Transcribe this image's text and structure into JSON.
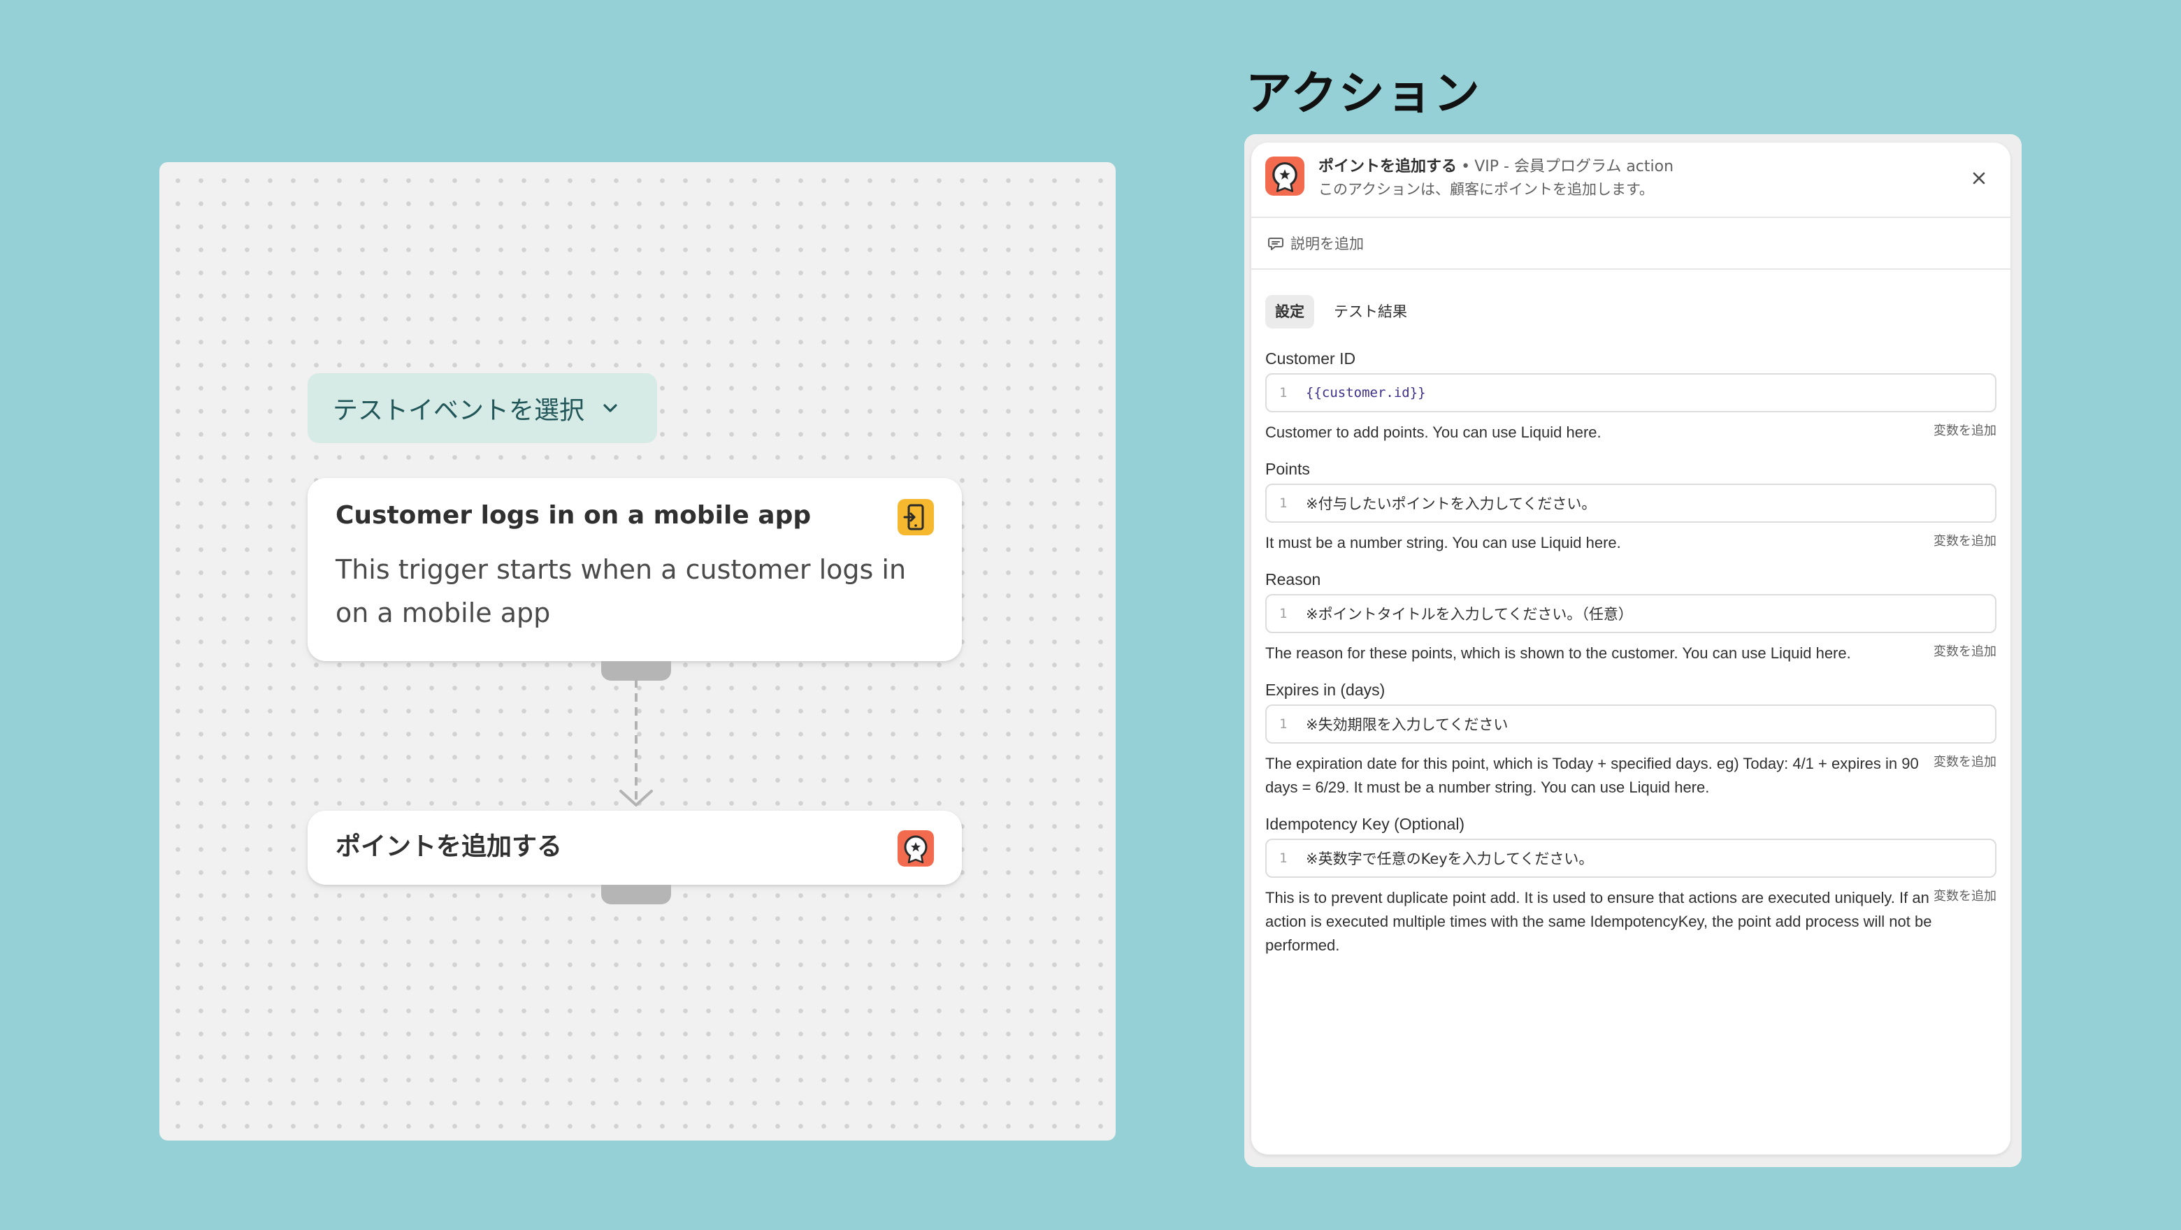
{
  "canvas": {
    "test_event_button": "テストイベントを選択",
    "trigger_node": {
      "title": "Customer logs in on a mobile app",
      "description": "This trigger starts when a customer logs in on a mobile app",
      "icon": "mobile-login-icon"
    },
    "action_node": {
      "title": "ポイントを追加する",
      "icon": "vip-badge-icon"
    }
  },
  "panel": {
    "heading": "アクション",
    "header": {
      "title": "ポイントを追加する",
      "separator": "•",
      "app_name": "VIP - 会員プログラム action",
      "subtitle": "このアクションは、顧客にポイントを追加します。"
    },
    "add_description": "説明を追加",
    "tabs": [
      {
        "label": "設定",
        "active": true
      },
      {
        "label": "テスト結果",
        "active": false
      }
    ],
    "add_variable_label": "変数を追加",
    "fields": [
      {
        "label": "Customer ID",
        "line": "1",
        "value": "{{customer.id}}",
        "help": "Customer to add points. You can use Liquid here."
      },
      {
        "label": "Points",
        "line": "1",
        "value": "※付与したいポイントを入力してください。",
        "help": "It must be a number string. You can use Liquid here."
      },
      {
        "label": "Reason",
        "line": "1",
        "value": "※ポイントタイトルを入力してください。（任意）",
        "help": "The reason for these points, which is shown to the customer. You can use Liquid here."
      },
      {
        "label": "Expires in (days)",
        "line": "1",
        "value": "※失効期限を入力してください",
        "help": "The expiration date for this point, which is Today + specified days. eg) Today: 4/1 + expires in 90 days = 6/29. It must be a number string. You can use Liquid here."
      },
      {
        "label": "Idempotency Key (Optional)",
        "line": "1",
        "value": "※英数字で任意のKeyを入力してください。",
        "help": "This is to prevent duplicate point add. It is used to ensure that actions are executed uniquely. If an action is executed multiple times with the same IdempotencyKey, the point add process will not be performed."
      }
    ]
  },
  "colors": {
    "background": "#94d0d6",
    "test_event_bg": "#d6eae6",
    "test_event_text": "#22575a",
    "trigger_icon_bg": "#f5b82e",
    "vip_icon_bg": "#f26b4f"
  }
}
